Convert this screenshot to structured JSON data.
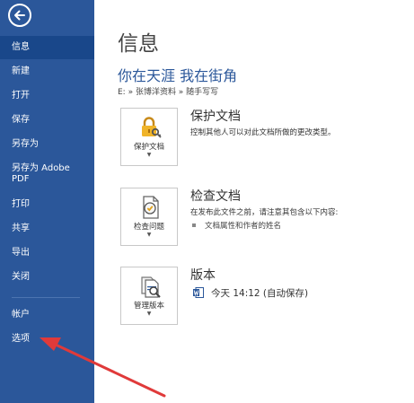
{
  "sidebar": {
    "items": [
      {
        "label": "信息",
        "active": true
      },
      {
        "label": "新建"
      },
      {
        "label": "打开"
      },
      {
        "label": "保存"
      },
      {
        "label": "另存为"
      },
      {
        "label": "另存为 Adobe PDF"
      },
      {
        "label": "打印"
      },
      {
        "label": "共享"
      },
      {
        "label": "导出"
      },
      {
        "label": "关闭"
      },
      {
        "label": "帐户"
      },
      {
        "label": "选项"
      }
    ],
    "bg_color": "#2b579a",
    "active_color": "#19478a"
  },
  "main": {
    "page_title": "信息",
    "doc_title": "你在天涯 我在街角",
    "doc_path": "E: » 张博洋资料 » 随手写写",
    "sections": [
      {
        "tile_label": "保护文档",
        "tile_icon": "lock-key-icon",
        "title": "保护文档",
        "desc": "控制其他人可以对此文档所做的更改类型。"
      },
      {
        "tile_label": "检查问题",
        "tile_icon": "inspect-document-icon",
        "title": "检查文档",
        "desc": "在发布此文件之前，请注意其包含以下内容:",
        "bullets": [
          "文档属性和作者的姓名"
        ]
      },
      {
        "tile_label": "管理版本",
        "tile_icon": "manage-versions-icon",
        "title": "版本",
        "version_entry": "今天 14:12 (自动保存)"
      }
    ],
    "accent_color": "#2b579a"
  },
  "annotation": {
    "arrow_color": "#e03a3a"
  }
}
